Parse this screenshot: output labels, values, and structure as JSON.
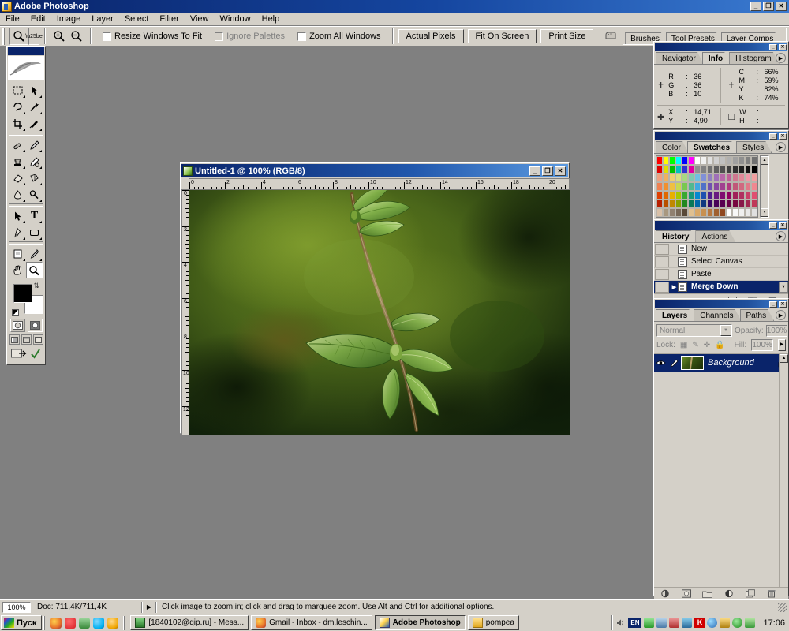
{
  "app": {
    "title": "Adobe Photoshop",
    "icon": "photoshop-icon",
    "minimize": "_",
    "maximize": "❐",
    "close": "✕"
  },
  "menubar": {
    "items": [
      {
        "label": "File"
      },
      {
        "label": "Edit"
      },
      {
        "label": "Image"
      },
      {
        "label": "Layer"
      },
      {
        "label": "Select"
      },
      {
        "label": "Filter"
      },
      {
        "label": "View"
      },
      {
        "label": "Window"
      },
      {
        "label": "Help"
      }
    ]
  },
  "options_bar": {
    "active_tool_icon": "zoom-tool-icon",
    "zoom_in_icon": "zoom-in-icon",
    "zoom_out_icon": "zoom-out-icon",
    "checkboxes": [
      {
        "label": "Resize Windows To Fit",
        "checked": false,
        "disabled": false
      },
      {
        "label": "Ignore Palettes",
        "checked": false,
        "disabled": true
      },
      {
        "label": "Zoom All Windows",
        "checked": false,
        "disabled": false
      }
    ],
    "buttons": [
      {
        "label": "Actual Pixels"
      },
      {
        "label": "Fit On Screen"
      },
      {
        "label": "Print Size"
      }
    ],
    "palette_well_icon": "palette-well-icon",
    "well_tabs": [
      {
        "label": "Brushes"
      },
      {
        "label": "Tool Presets"
      },
      {
        "label": "Layer Comps"
      }
    ]
  },
  "toolbox": {
    "logo_icon": "photoshop-feather-logo",
    "tools": [
      {
        "name": "marquee-tool",
        "icon": "⬚",
        "has_flyout": true,
        "selected": false
      },
      {
        "name": "move-tool",
        "icon": "⬈",
        "has_flyout": false,
        "selected": false
      },
      {
        "name": "lasso-tool",
        "icon": "⊂",
        "has_flyout": true,
        "selected": false
      },
      {
        "name": "magic-wand-tool",
        "icon": "✱",
        "has_flyout": false,
        "selected": false
      },
      {
        "name": "crop-tool",
        "icon": "⌗",
        "has_flyout": false,
        "selected": false
      },
      {
        "name": "slice-tool",
        "icon": "∕",
        "has_flyout": true,
        "selected": false
      },
      {
        "name": "healing-brush-tool",
        "icon": "✐",
        "has_flyout": true,
        "selected": false
      },
      {
        "name": "brush-tool",
        "icon": "✎",
        "has_flyout": true,
        "selected": false
      },
      {
        "name": "clone-stamp-tool",
        "icon": "⚲",
        "has_flyout": true,
        "selected": false
      },
      {
        "name": "history-brush-tool",
        "icon": "✒",
        "has_flyout": true,
        "selected": false
      },
      {
        "name": "eraser-tool",
        "icon": "▱",
        "has_flyout": true,
        "selected": false
      },
      {
        "name": "gradient-tool",
        "icon": "◧",
        "has_flyout": true,
        "selected": false
      },
      {
        "name": "blur-tool",
        "icon": "●",
        "has_flyout": true,
        "selected": false
      },
      {
        "name": "dodge-tool",
        "icon": "⚬",
        "has_flyout": true,
        "selected": false
      },
      {
        "name": "path-selection-tool",
        "icon": "▶",
        "has_flyout": true,
        "selected": false
      },
      {
        "name": "type-tool",
        "icon": "T",
        "has_flyout": true,
        "selected": false
      },
      {
        "name": "pen-tool",
        "icon": "✒",
        "has_flyout": true,
        "selected": false
      },
      {
        "name": "shape-tool",
        "icon": "▭",
        "has_flyout": true,
        "selected": false
      },
      {
        "name": "notes-tool",
        "icon": "☰",
        "has_flyout": true,
        "selected": false
      },
      {
        "name": "eyedropper-tool",
        "icon": "⚗",
        "has_flyout": true,
        "selected": false
      },
      {
        "name": "hand-tool",
        "icon": "✋",
        "has_flyout": false,
        "selected": false
      },
      {
        "name": "zoom-tool",
        "icon": "⚲",
        "has_flyout": false,
        "selected": true
      }
    ],
    "foreground_color": "#000000",
    "background_color": "#ffffff",
    "swap_icon": "swap-colors-icon",
    "reset_icon": "reset-colors-icon",
    "mode_buttons": [
      {
        "name": "standard-mask-mode",
        "icon": "◯",
        "active": true
      },
      {
        "name": "quick-mask-mode",
        "icon": "◐",
        "active": false
      }
    ],
    "screen_modes": [
      {
        "name": "standard-screen-mode",
        "icon": "▣"
      },
      {
        "name": "full-screen-menubar-mode",
        "icon": "▭"
      },
      {
        "name": "full-screen-mode",
        "icon": "□"
      }
    ],
    "jump_to": [
      {
        "name": "jump-to-imageready",
        "icon": "↪"
      },
      {
        "name": "jump-checkmark",
        "icon": "✔"
      }
    ]
  },
  "document": {
    "title": "Untitled-1 @ 100% (RGB/8)",
    "icon": "document-icon",
    "minimize": "_",
    "maximize": "❐",
    "close": "✕",
    "ruler_units": "cm",
    "ruler_h_labels": [
      "0",
      "2",
      "4",
      "6",
      "8",
      "10",
      "12",
      "14",
      "16",
      "18",
      "20"
    ],
    "ruler_v_labels": [
      "0",
      "2",
      "4",
      "6",
      "8",
      "10",
      "12"
    ],
    "image_description": "Close-up photo of a nettle plant stem with young green leaves against a blurred green bokeh background"
  },
  "info_palette": {
    "titlebar_buttons": [
      {
        "label": "_",
        "name": "minimize"
      },
      {
        "label": "✕",
        "name": "close"
      }
    ],
    "tabs": [
      {
        "label": "Navigator",
        "active": false
      },
      {
        "label": "Info",
        "active": true
      },
      {
        "label": "Histogram",
        "active": false
      }
    ],
    "menu_icon": "palette-menu-icon",
    "left_icon": "eyedropper-icon",
    "right_icon": "eyedropper-icon",
    "rgb": [
      {
        "key": "R",
        "value": "36"
      },
      {
        "key": "G",
        "value": "36"
      },
      {
        "key": "B",
        "value": "10"
      }
    ],
    "cmyk": [
      {
        "key": "C",
        "value": "66%"
      },
      {
        "key": "M",
        "value": "59%"
      },
      {
        "key": "Y",
        "value": "82%"
      },
      {
        "key": "K",
        "value": "74%"
      }
    ],
    "position_icon": "crosshair-icon",
    "position": [
      {
        "key": "X",
        "value": "14,71"
      },
      {
        "key": "Y",
        "value": "4,90"
      }
    ],
    "size_icon": "selection-size-icon",
    "size": [
      {
        "key": "W",
        "value": ""
      },
      {
        "key": "H",
        "value": ""
      }
    ]
  },
  "swatches_palette": {
    "titlebar_buttons": [
      {
        "label": "_",
        "name": "minimize"
      },
      {
        "label": "✕",
        "name": "close"
      }
    ],
    "tabs": [
      {
        "label": "Color",
        "active": false
      },
      {
        "label": "Swatches",
        "active": true
      },
      {
        "label": "Styles",
        "active": false
      }
    ],
    "menu_icon": "palette-menu-icon",
    "scroll_up_icon": "▴",
    "scroll_down_icon": "▾",
    "colors": [
      "#ff0000",
      "#ffff00",
      "#00ff00",
      "#00ffff",
      "#0000ff",
      "#ff00ff",
      "#ffffff",
      "#f0f0f0",
      "#e0e0e0",
      "#d0d0d0",
      "#c0c0c0",
      "#b0b0b0",
      "#a0a0a0",
      "#909090",
      "#808080",
      "#707070",
      "#e00000",
      "#e0e000",
      "#00c000",
      "#00c0c0",
      "#3030d0",
      "#e000a0",
      "#909090",
      "#808080",
      "#707070",
      "#606060",
      "#505050",
      "#404040",
      "#303030",
      "#202020",
      "#101010",
      "#000000",
      "#f0a080",
      "#f0b060",
      "#f0d070",
      "#d8e080",
      "#a8d880",
      "#80c8b0",
      "#70c0e0",
      "#8090d8",
      "#9080c0",
      "#a070b8",
      "#b868a8",
      "#c06098",
      "#d07890",
      "#e08898",
      "#f098a8",
      "#f0a0a0",
      "#f08050",
      "#f09030",
      "#f0c040",
      "#c8d850",
      "#78c850",
      "#50b890",
      "#40a8e0",
      "#5070c8",
      "#7050b0",
      "#8848a0",
      "#a04090",
      "#b03880",
      "#c05878",
      "#d06880",
      "#e07888",
      "#f08890",
      "#e04000",
      "#e06800",
      "#e8b000",
      "#a8c800",
      "#38a830",
      "#189878",
      "#0888d0",
      "#2050b0",
      "#502090",
      "#681c80",
      "#800c70",
      "#900060",
      "#a02058",
      "#b03060",
      "#c84068",
      "#e05070",
      "#b82000",
      "#b85000",
      "#c08800",
      "#88a000",
      "#208820",
      "#087858",
      "#0068a8",
      "#103880",
      "#380868",
      "#480458",
      "#580050",
      "#680048",
      "#780840",
      "#881848",
      "#a02850",
      "#c03858",
      "#d8c0a8",
      "#a89880",
      "#908070",
      "#786858",
      "#584838",
      "#e0c090",
      "#d8a868",
      "#c89050",
      "#b87840",
      "#a06030",
      "#904820",
      "#ffffff",
      "#f8f8f8",
      "#f0f0f0",
      "#e8e8e8",
      "#e0e0e0"
    ]
  },
  "history_palette": {
    "titlebar_buttons": [
      {
        "label": "_",
        "name": "minimize"
      },
      {
        "label": "✕",
        "name": "close"
      }
    ],
    "tabs": [
      {
        "label": "History",
        "active": true
      },
      {
        "label": "Actions",
        "active": false
      }
    ],
    "menu_icon": "palette-menu-icon",
    "states": [
      {
        "label": "New",
        "selected": false,
        "current": false
      },
      {
        "label": "Select Canvas",
        "selected": false,
        "current": false
      },
      {
        "label": "Paste",
        "selected": false,
        "current": false
      },
      {
        "label": "Merge Down",
        "selected": true,
        "current": true
      }
    ],
    "scroll_up_icon": "▴",
    "scroll_down_icon": "▾",
    "footer_buttons": [
      {
        "name": "create-document-from-state-icon",
        "icon": "▤"
      },
      {
        "name": "create-new-snapshot-icon",
        "icon": "⧉"
      },
      {
        "name": "delete-state-icon",
        "icon": "⌧"
      }
    ]
  },
  "layers_palette": {
    "titlebar_buttons": [
      {
        "label": "_",
        "name": "minimize"
      },
      {
        "label": "✕",
        "name": "close"
      }
    ],
    "tabs": [
      {
        "label": "Layers",
        "active": true
      },
      {
        "label": "Channels",
        "active": false
      },
      {
        "label": "Paths",
        "active": false
      }
    ],
    "menu_icon": "palette-menu-icon",
    "blend_mode": "Normal",
    "opacity_label": "Opacity:",
    "opacity_value": "100%",
    "lock_label": "Lock:",
    "lock_icons": [
      {
        "name": "lock-transparency-icon",
        "icon": "▨"
      },
      {
        "name": "lock-image-icon",
        "icon": "✎"
      },
      {
        "name": "lock-position-icon",
        "icon": "✛"
      },
      {
        "name": "lock-all-icon",
        "icon": "⚿"
      }
    ],
    "fill_label": "Fill:",
    "fill_value": "100%",
    "layers": [
      {
        "name": "Background",
        "visible": true,
        "visibility_icon": "eye-icon",
        "edit_icon": "brush-icon",
        "locked": true,
        "lock_icon": "lock-icon",
        "selected": true
      }
    ],
    "footer_buttons": [
      {
        "name": "layer-style-icon",
        "icon": "◑"
      },
      {
        "name": "layer-mask-icon",
        "icon": "▣"
      },
      {
        "name": "new-group-icon",
        "icon": "☐"
      },
      {
        "name": "new-fill-adjustment-icon",
        "icon": "◐"
      },
      {
        "name": "new-layer-icon",
        "icon": "⧉"
      },
      {
        "name": "delete-layer-icon",
        "icon": "⌧"
      }
    ]
  },
  "status_bar": {
    "zoom": "100%",
    "doc_info": "Doc: 711,4K/711,4K",
    "arrow_icon": "▶",
    "hint": "Click image to zoom in; click and drag to marquee zoom.  Use Alt and Ctrl for additional options."
  },
  "taskbar": {
    "start_label": "Пуск",
    "start_icon": "windows-flag-icon",
    "quick_launch": [
      {
        "name": "firefox-icon",
        "color": "#e8762c"
      },
      {
        "name": "opera-icon",
        "color": "#d91f26"
      },
      {
        "name": "utorrent-icon",
        "color": "#5bb75b"
      },
      {
        "name": "skype-icon",
        "color": "#00aff0"
      },
      {
        "name": "media-player-icon",
        "color": "#f0a500"
      }
    ],
    "windows": [
      {
        "label": "[1840102@qip.ru] - Mess...",
        "icon": "qip-icon",
        "icon_color": "#3a9a3a",
        "active": false
      },
      {
        "label": "Gmail - Inbox - dm.leschin...",
        "icon": "firefox-icon",
        "icon_color": "#e8762c",
        "active": false
      },
      {
        "label": "Adobe Photoshop",
        "icon": "photoshop-icon",
        "icon_color": "#2a5fb5",
        "active": true
      },
      {
        "label": "pompea",
        "icon": "folder-icon",
        "icon_color": "#f0c040",
        "active": false
      }
    ],
    "tray": [
      {
        "name": "volume-icon",
        "color": "#707070"
      },
      {
        "name": "language-indicator",
        "label": "EN"
      },
      {
        "name": "network-icon",
        "color": "#3a9a3a"
      },
      {
        "name": "printer-icon",
        "color": "#5a8ab0"
      },
      {
        "name": "speaker-icon",
        "color": "#c04040"
      },
      {
        "name": "kaspersky-icon",
        "color": "#e04040"
      },
      {
        "name": "k-icon",
        "color": "#d00000"
      },
      {
        "name": "globe-icon",
        "color": "#3a7ad0"
      },
      {
        "name": "security-icon",
        "color": "#c8a020"
      },
      {
        "name": "shield-ok-icon",
        "color": "#2aa02a"
      },
      {
        "name": "update-icon",
        "color": "#4aa04a"
      }
    ],
    "clock": "17:06"
  }
}
